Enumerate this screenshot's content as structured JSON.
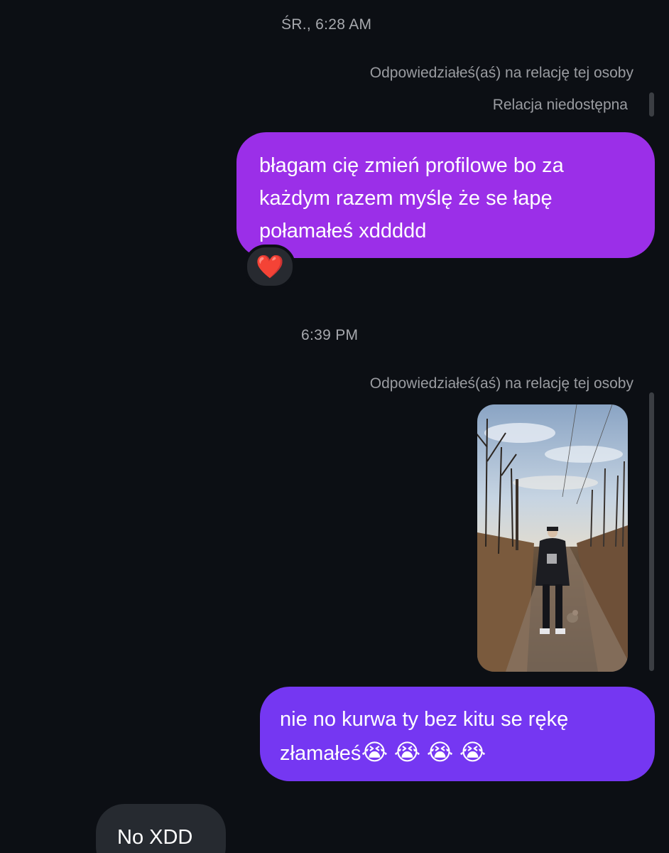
{
  "conversation": {
    "timestamp_1": "ŚR., 6:28 AM",
    "story_reply_label_1": "Odpowiedziałeś(aś) na relację tej osoby",
    "story_unavailable": "Relacja niedostępna",
    "message_1": "błagam cię zmień profilowe bo za każdym razem myślę że se łapę połamałeś xddddd",
    "reaction_1": "❤️",
    "timestamp_2": "6:39 PM",
    "story_reply_label_2": "Odpowiedziałeś(aś) na relację tej osoby",
    "message_2_text": "nie no kurwa ty bez kitu se rękę złamałeś",
    "message_2_emojis": [
      "😭",
      "😭",
      "😭",
      "😭"
    ],
    "message_3": "No XDD"
  },
  "colors": {
    "background": "#0c0f14",
    "outgoing_bubble_1": "#9b2fe8",
    "outgoing_bubble_2": "#7537f2",
    "incoming_bubble": "#262a30",
    "meta_text": "#9a9ca1"
  }
}
